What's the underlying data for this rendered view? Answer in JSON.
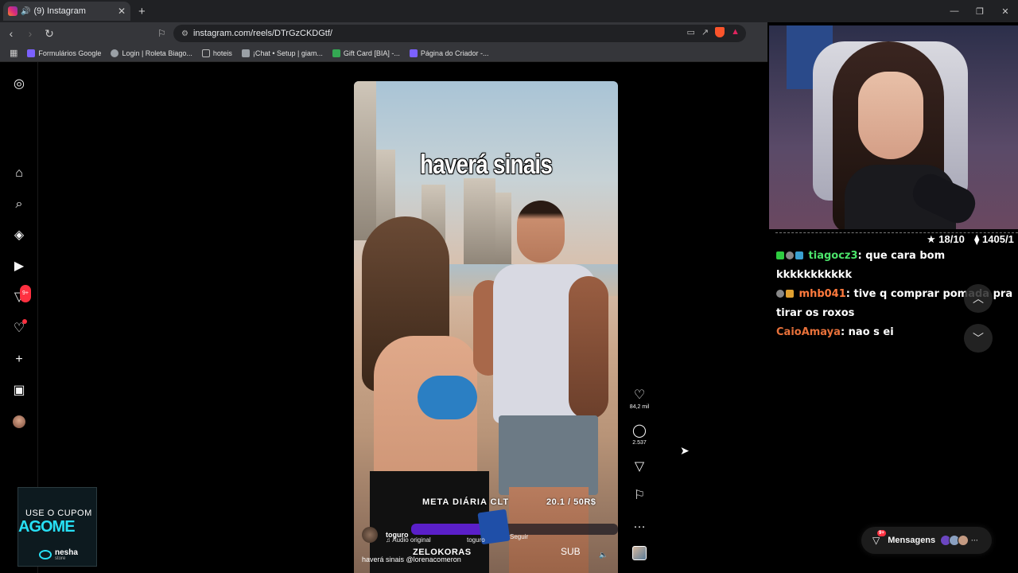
{
  "browser": {
    "tab_title": "(9) Instagram",
    "new_tab": "+",
    "url": "instagram.com/reels/DTrGzCKDGtf/",
    "bookmarks": [
      {
        "label": "Formulários Google",
        "color": "#7b61ff"
      },
      {
        "label": "Login | Roleta Biago...",
        "color": "#9aa0a6"
      },
      {
        "label": "hoteis",
        "color": "#9aa0a6"
      },
      {
        "label": "¡Chat • Setup | giam...",
        "color": "#9aa0a6"
      },
      {
        "label": "Gift Card [BIA] -...",
        "color": "#34a853"
      },
      {
        "label": "Página do Criador -...",
        "color": "#7b61ff"
      }
    ]
  },
  "instagram": {
    "sidebar_icons": [
      "instagram-logo-icon",
      "home-icon",
      "search-icon",
      "explore-icon",
      "reels-icon",
      "messages-icon",
      "notifications-icon",
      "create-icon",
      "dashboard-icon",
      "profile-avatar"
    ],
    "messages_badge": "9+",
    "reel": {
      "overlay_text": "haverá sinais",
      "goal_label": "META DIÁRIA CLT",
      "goal_value": "20.1 / 50R$",
      "goal_progress": 0.4,
      "username": "toguro",
      "audio": "Áudio original",
      "audio_user": "toguro",
      "follow": "Seguir",
      "overlay_brand": "ZELOKORAS",
      "overlay_sub": "SUB",
      "description": "haverá sinais @lorenacomeron"
    },
    "actions": {
      "likes": "84,2 mil",
      "comments": "2.537"
    },
    "messages_pill": {
      "label": "Mensagens",
      "badge": "9+"
    }
  },
  "promo": {
    "line1": "USE O CUPOM",
    "line2": "AGOME",
    "brand": "nesha",
    "brand_sub": "store"
  },
  "stream": {
    "stat_rating": "★ 18/10",
    "stat_count": "⧫ 1405/1",
    "chat": [
      {
        "user": "tiagocz3",
        "message": "que cara bom kkkkkkkkkkk",
        "color": "#4be36a"
      },
      {
        "user": "mhb041",
        "message": "tive q comprar pomada pra tirar os roxos",
        "color": "#ff7a3d"
      },
      {
        "user": "CaioAmaya",
        "message": "nao s ei",
        "color": "#e8713a"
      }
    ]
  }
}
